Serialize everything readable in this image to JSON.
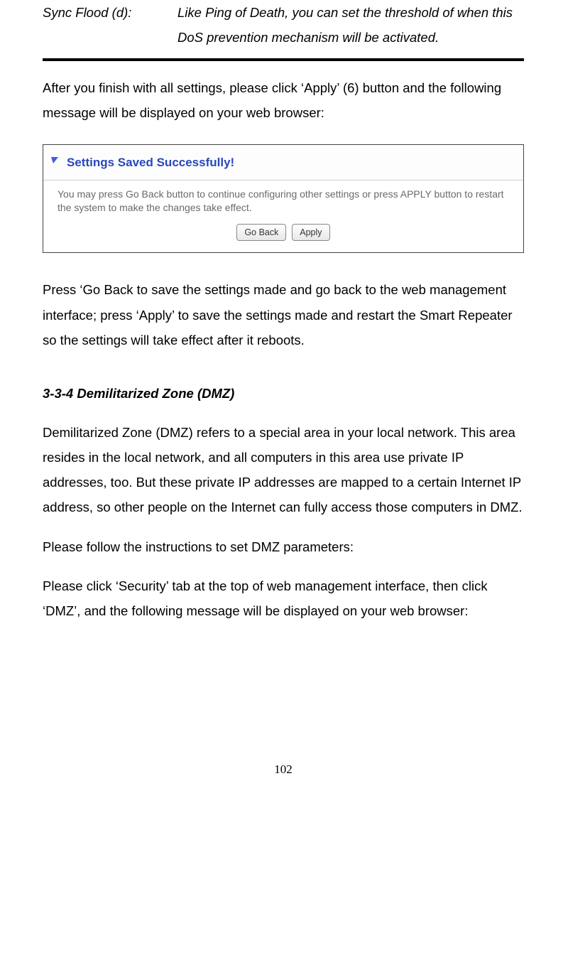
{
  "def": {
    "term": "Sync Flood (d):",
    "desc": "Like Ping of Death, you can set the threshold of when this DoS prevention mechanism will be activated."
  },
  "para_apply": "After you finish with all settings, please click ‘Apply’ (6) button and the following message will be displayed on your web browser:",
  "screenshot": {
    "title": "Settings Saved Successfully!",
    "body": "You may press Go Back button to continue configuring other settings or press APPLY button to restart the system to make the changes take effect.",
    "btn_goback": "Go Back",
    "btn_apply": "Apply"
  },
  "para_goback": "Press ‘Go Back to save the settings made and go back to the web management interface; press ‘Apply’ to save the settings made and restart the Smart Repeater so the settings will take effect after it reboots.",
  "section_heading": "3-3-4 Demilitarized Zone (DMZ)",
  "para_dmz1": "Demilitarized Zone (DMZ) refers to a special area in your local network. This area resides in the local network, and all computers in this area use private IP addresses, too. But these private IP addresses are mapped to a certain Internet IP address, so other people on the Internet can fully access those computers in DMZ.",
  "para_dmz2": "Please follow the instructions to set DMZ parameters:",
  "para_dmz3": "Please click ‘Security’ tab at the top of web management interface, then click ‘DMZ’, and the following message will be displayed on your web browser:",
  "page_number": "102"
}
